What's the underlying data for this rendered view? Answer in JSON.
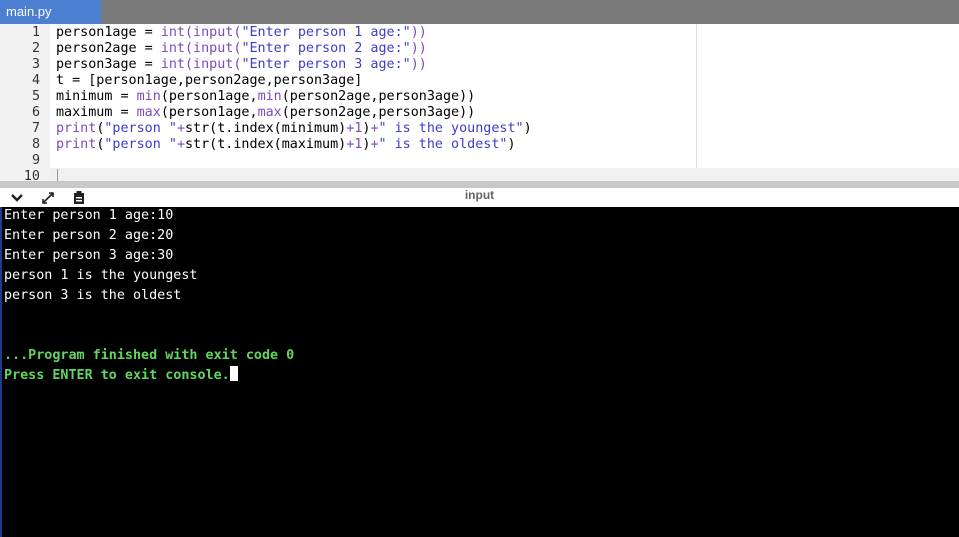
{
  "tab": {
    "label": "main.py"
  },
  "editor": {
    "lines": [
      {
        "num": "1",
        "parts": [
          [
            "person1age = ",
            ""
          ],
          [
            "int(input(",
            "fn"
          ],
          [
            "\"Enter person 1 age:\"",
            "str"
          ],
          [
            "))",
            "fn"
          ]
        ]
      },
      {
        "num": "2",
        "parts": [
          [
            "person2age = ",
            ""
          ],
          [
            "int(input(",
            "fn"
          ],
          [
            "\"Enter person 2 age:\"",
            "str"
          ],
          [
            "))",
            "fn"
          ]
        ]
      },
      {
        "num": "3",
        "parts": [
          [
            "person3age = ",
            ""
          ],
          [
            "int(input(",
            "fn"
          ],
          [
            "\"Enter person 3 age:\"",
            "str"
          ],
          [
            "))",
            "fn"
          ]
        ]
      },
      {
        "num": "4",
        "parts": [
          [
            "t = [person1age,person2age,person3age]",
            ""
          ]
        ]
      },
      {
        "num": "5",
        "parts": [
          [
            "minimum = ",
            ""
          ],
          [
            "min",
            "fn"
          ],
          [
            "(person1age,",
            ""
          ],
          [
            "min",
            "fn"
          ],
          [
            "(person2age,person3age))",
            ""
          ]
        ]
      },
      {
        "num": "6",
        "parts": [
          [
            "maximum = ",
            ""
          ],
          [
            "max",
            "fn"
          ],
          [
            "(person1age,",
            ""
          ],
          [
            "max",
            "fn"
          ],
          [
            "(person2age,person3age))",
            ""
          ]
        ]
      },
      {
        "num": "7",
        "parts": [
          [
            "print",
            "fn"
          ],
          [
            "(",
            ""
          ],
          [
            "\"person \"",
            "str"
          ],
          [
            "+",
            "op"
          ],
          [
            "str(t.index(minimum)",
            ""
          ],
          [
            "+1",
            "op"
          ],
          [
            ")",
            ""
          ],
          [
            "+",
            "op"
          ],
          [
            "\" is the youngest\"",
            "str"
          ],
          [
            ")",
            ""
          ]
        ]
      },
      {
        "num": "8",
        "parts": [
          [
            "print",
            "fn"
          ],
          [
            "(",
            ""
          ],
          [
            "\"person \"",
            "str"
          ],
          [
            "+",
            "op"
          ],
          [
            "str(t.index(maximum)",
            ""
          ],
          [
            "+1",
            "op"
          ],
          [
            ")",
            ""
          ],
          [
            "+",
            "op"
          ],
          [
            "\" is the oldest\"",
            "str"
          ],
          [
            ")",
            ""
          ]
        ]
      },
      {
        "num": "9",
        "parts": []
      },
      {
        "num": "10",
        "parts": []
      }
    ]
  },
  "console": {
    "title": "input",
    "toolbar_icons": [
      "chevron-down-icon",
      "expand-icon",
      "clipboard-icon"
    ],
    "lines": [
      "Enter person 1 age:10",
      "Enter person 2 age:20",
      "Enter person 3 age:30",
      "person 1 is the youngest",
      "person 3 is the oldest",
      "",
      "",
      "...Program finished with exit code 0",
      "Press ENTER to exit console."
    ],
    "highlight_lines": [
      7,
      8
    ],
    "highlight_color": "#5fd75f"
  },
  "colors": {
    "tab_active": "#4b7fd1",
    "tab_bar": "#7a7a7a",
    "function": "#7b4bbd",
    "string": "#3d3dc8"
  }
}
